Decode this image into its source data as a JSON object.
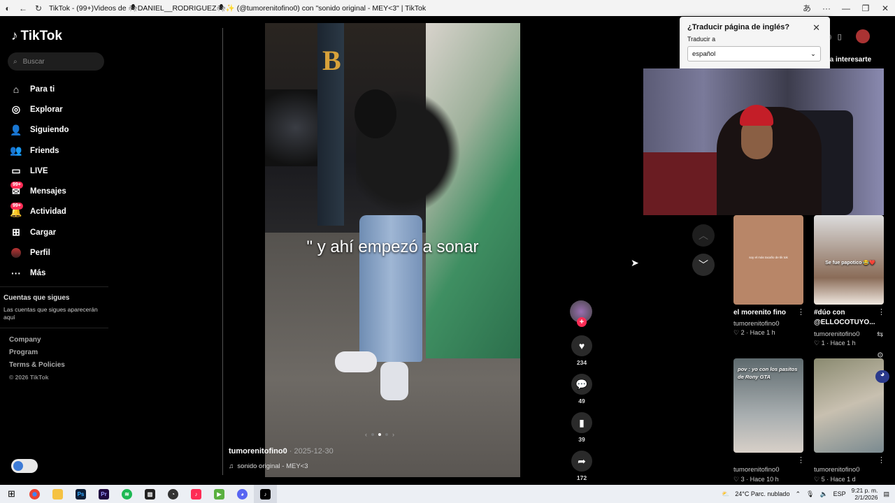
{
  "browser": {
    "title": "TikTok - (99+)Videos de 🕷DANIEL__RODRIGUEZ🕷✨ (@tumorenitofino0) con \"sonido original - MEY<3\" | TikTok"
  },
  "sidebar": {
    "logo": "TikTok",
    "search_placeholder": "Buscar",
    "items": [
      {
        "label": "Para ti",
        "icon": "home-icon",
        "glyph": "⌂"
      },
      {
        "label": "Explorar",
        "icon": "compass-icon",
        "glyph": "◎"
      },
      {
        "label": "Siguiendo",
        "icon": "following-icon",
        "glyph": "👤"
      },
      {
        "label": "Friends",
        "icon": "friends-icon",
        "glyph": "👥"
      },
      {
        "label": "LIVE",
        "icon": "live-icon",
        "glyph": "▭"
      },
      {
        "label": "Mensajes",
        "icon": "messages-icon",
        "glyph": "✉",
        "badge": "99+"
      },
      {
        "label": "Actividad",
        "icon": "activity-icon",
        "glyph": "🔔",
        "badge": "99+"
      },
      {
        "label": "Cargar",
        "icon": "upload-icon",
        "glyph": "⊞"
      },
      {
        "label": "Perfil",
        "icon": "profile-avatar",
        "glyph": ""
      },
      {
        "label": "Más",
        "icon": "more-icon",
        "glyph": "···"
      }
    ],
    "following_title": "Cuentas que sigues",
    "following_desc": "Las cuentas que sigues aparecerán aquí",
    "footer": [
      "Company",
      "Program",
      "Terms & Policies"
    ],
    "copyright": "© 2026 TikTok"
  },
  "video": {
    "caption": "\" y ahí empezó a sonar",
    "author": "tumorenitofino0",
    "date": "· 2025-12-30",
    "sound": "sonido original - MEY<3",
    "likes": "234",
    "comments": "49",
    "saves": "39",
    "shares": "172"
  },
  "translate": {
    "title": "¿Traducir página de inglés?",
    "sub": "Traducir a",
    "language": "español"
  },
  "right_header": "ría interesarte",
  "cards": [
    {
      "title": "el morenito fino",
      "user": "tumorenitofino0",
      "likes": "2",
      "time": "Hace 1 h",
      "thumb_text": "soy el más tacaño de tik tok"
    },
    {
      "title": "#dúo con @ELLOCOTUYO...",
      "user": "tumorenitofino0",
      "likes": "1",
      "time": "Hace 1 h",
      "thumb_text": "Se fue papotico 😂❤️"
    },
    {
      "title": "",
      "user": "tumorenitofino0",
      "likes": "3",
      "time": "Hace 10 h",
      "thumb_text": "pov : yo con los pasitos de Rony GTA"
    },
    {
      "title": "",
      "user": "tumorenitofino0",
      "likes": "5",
      "time": "Hace 1 d",
      "thumb_text": ""
    }
  ],
  "taskbar": {
    "weather": "24°C  Parc. nublado",
    "lang": "ESP",
    "time": "9:21 p. m.",
    "date": "2/1/2026"
  }
}
